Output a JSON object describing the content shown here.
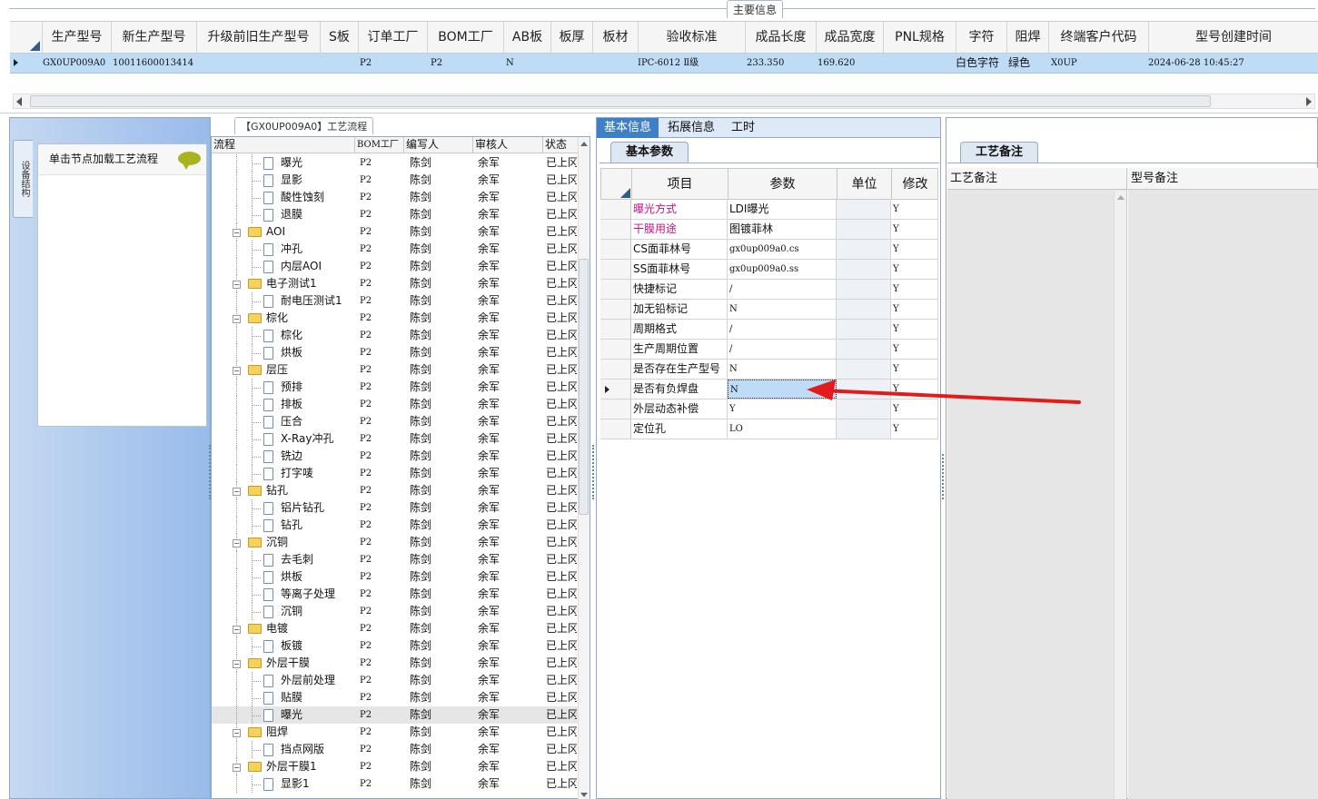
{
  "top": {
    "section_tab": "主要信息",
    "columns": [
      "生产型号",
      "新生产型号",
      "升级前旧生产型号",
      "S板",
      "订单工厂",
      "BOM工厂",
      "AB板",
      "板厚",
      "板材",
      "验收标准",
      "成品长度",
      "成品宽度",
      "PNL规格",
      "字符",
      "阻焊",
      "终端客户代码",
      "型号创建时间"
    ],
    "row": {
      "model": "GX0UP009A0",
      "new_model": "10011600013414",
      "old_model": "",
      "s_board": "",
      "order_factory": "P2",
      "bom_factory": "P2",
      "ab_board": "N",
      "thickness": "",
      "material": "",
      "standard": "IPC-6012 Ⅱ级",
      "length": "233.350",
      "width": "169.620",
      "pnl": "",
      "char": "白色字符",
      "mask": "绿色",
      "customer": "X0UP",
      "created": "2024-06-28 10:45:27"
    }
  },
  "left": {
    "vertical_tab": "设备结构",
    "hint": "单击节点加载工艺流程"
  },
  "tree": {
    "title": "【GX0UP009A0】工艺流程",
    "headers": {
      "flow": "流程",
      "bom": "BOM工厂",
      "author": "编写人",
      "auditor": "审核人",
      "status": "状态"
    },
    "rows": [
      {
        "name": "曝光",
        "level": 2,
        "bom": "P2",
        "author": "陈剑",
        "auditor": "余军",
        "status": "已上冈"
      },
      {
        "name": "显影",
        "level": 2,
        "bom": "P2",
        "author": "陈剑",
        "auditor": "余军",
        "status": "已上冈"
      },
      {
        "name": "酸性蚀刻",
        "level": 2,
        "bom": "P2",
        "author": "陈剑",
        "auditor": "余军",
        "status": "已上冈"
      },
      {
        "name": "退膜",
        "level": 2,
        "bom": "P2",
        "author": "陈剑",
        "auditor": "余军",
        "status": "已上冈"
      },
      {
        "name": "AOI",
        "level": 1,
        "bom": "P2",
        "author": "陈剑",
        "auditor": "余军",
        "status": "已上冈"
      },
      {
        "name": "冲孔",
        "level": 2,
        "bom": "P2",
        "author": "陈剑",
        "auditor": "余军",
        "status": "已上冈"
      },
      {
        "name": "内层AOI",
        "level": 2,
        "bom": "P2",
        "author": "陈剑",
        "auditor": "余军",
        "status": "已上冈"
      },
      {
        "name": "电子测试1",
        "level": 1,
        "bom": "P2",
        "author": "陈剑",
        "auditor": "余军",
        "status": "已上冈"
      },
      {
        "name": "耐电压测试1",
        "level": 2,
        "bom": "P2",
        "author": "陈剑",
        "auditor": "余军",
        "status": "已上冈"
      },
      {
        "name": "棕化",
        "level": 1,
        "bom": "P2",
        "author": "陈剑",
        "auditor": "余军",
        "status": "已上冈"
      },
      {
        "name": "棕化",
        "level": 2,
        "bom": "P2",
        "author": "陈剑",
        "auditor": "余军",
        "status": "已上冈"
      },
      {
        "name": "烘板",
        "level": 2,
        "bom": "P2",
        "author": "陈剑",
        "auditor": "余军",
        "status": "已上冈"
      },
      {
        "name": "层压",
        "level": 1,
        "bom": "P2",
        "author": "陈剑",
        "auditor": "余军",
        "status": "已上冈"
      },
      {
        "name": "预排",
        "level": 2,
        "bom": "P2",
        "author": "陈剑",
        "auditor": "余军",
        "status": "已上冈"
      },
      {
        "name": "排板",
        "level": 2,
        "bom": "P2",
        "author": "陈剑",
        "auditor": "余军",
        "status": "已上冈"
      },
      {
        "name": "压合",
        "level": 2,
        "bom": "P2",
        "author": "陈剑",
        "auditor": "余军",
        "status": "已上冈"
      },
      {
        "name": "X-Ray冲孔",
        "level": 2,
        "bom": "P2",
        "author": "陈剑",
        "auditor": "余军",
        "status": "已上冈"
      },
      {
        "name": "铣边",
        "level": 2,
        "bom": "P2",
        "author": "陈剑",
        "auditor": "余军",
        "status": "已上冈"
      },
      {
        "name": "打字唛",
        "level": 2,
        "bom": "P2",
        "author": "陈剑",
        "auditor": "余军",
        "status": "已上冈"
      },
      {
        "name": "钻孔",
        "level": 1,
        "bom": "P2",
        "author": "陈剑",
        "auditor": "余军",
        "status": "已上冈"
      },
      {
        "name": "铝片钻孔",
        "level": 2,
        "bom": "P2",
        "author": "陈剑",
        "auditor": "余军",
        "status": "已上冈"
      },
      {
        "name": "钻孔",
        "level": 2,
        "bom": "P2",
        "author": "陈剑",
        "auditor": "余军",
        "status": "已上冈"
      },
      {
        "name": "沉铜",
        "level": 1,
        "bom": "P2",
        "author": "陈剑",
        "auditor": "余军",
        "status": "已上冈"
      },
      {
        "name": "去毛刺",
        "level": 2,
        "bom": "P2",
        "author": "陈剑",
        "auditor": "余军",
        "status": "已上冈"
      },
      {
        "name": "烘板",
        "level": 2,
        "bom": "P2",
        "author": "陈剑",
        "auditor": "余军",
        "status": "已上冈"
      },
      {
        "name": "等离子处理",
        "level": 2,
        "bom": "P2",
        "author": "陈剑",
        "auditor": "余军",
        "status": "已上冈"
      },
      {
        "name": "沉铜",
        "level": 2,
        "bom": "P2",
        "author": "陈剑",
        "auditor": "余军",
        "status": "已上冈"
      },
      {
        "name": "电镀",
        "level": 1,
        "bom": "P2",
        "author": "陈剑",
        "auditor": "余军",
        "status": "已上冈"
      },
      {
        "name": "板镀",
        "level": 2,
        "bom": "P2",
        "author": "陈剑",
        "auditor": "余军",
        "status": "已上冈"
      },
      {
        "name": "外层干膜",
        "level": 1,
        "bom": "P2",
        "author": "陈剑",
        "auditor": "余军",
        "status": "已上冈"
      },
      {
        "name": "外层前处理",
        "level": 2,
        "bom": "P2",
        "author": "陈剑",
        "auditor": "余军",
        "status": "已上冈"
      },
      {
        "name": "贴膜",
        "level": 2,
        "bom": "P2",
        "author": "陈剑",
        "auditor": "余军",
        "status": "已上冈"
      },
      {
        "name": "曝光",
        "level": 2,
        "bom": "P2",
        "author": "陈剑",
        "auditor": "余军",
        "status": "已上冈",
        "selected": true
      },
      {
        "name": "阻焊",
        "level": 1,
        "bom": "P2",
        "author": "陈剑",
        "auditor": "余军",
        "status": "已上冈"
      },
      {
        "name": "挡点网版",
        "level": 2,
        "bom": "P2",
        "author": "陈剑",
        "auditor": "余军",
        "status": "已上冈"
      },
      {
        "name": "外层干膜1",
        "level": 1,
        "bom": "P2",
        "author": "陈剑",
        "auditor": "余军",
        "status": "已上冈"
      },
      {
        "name": "显影1",
        "level": 2,
        "bom": "P2",
        "author": "陈剑",
        "auditor": "余军",
        "status": "已上冈"
      }
    ]
  },
  "middle": {
    "tabs": [
      "基本信息",
      "拓展信息",
      "工时"
    ],
    "sub_tab": "基本参数",
    "headers": {
      "item": "项目",
      "param": "参数",
      "unit": "单位",
      "modify": "修改"
    },
    "rows": [
      {
        "item": "曝光方式",
        "param": "LDI曝光",
        "unit": "",
        "modify": "Y",
        "highlight": true
      },
      {
        "item": "干膜用途",
        "param": "图镀菲林",
        "unit": "",
        "modify": "Y",
        "highlight": true
      },
      {
        "item": "CS面菲林号",
        "param": "gx0up009a0.cs",
        "unit": "",
        "modify": "Y"
      },
      {
        "item": "SS面菲林号",
        "param": "gx0up009a0.ss",
        "unit": "",
        "modify": "Y"
      },
      {
        "item": "快捷标记",
        "param": "/",
        "unit": "",
        "modify": "Y"
      },
      {
        "item": "加无铅标记",
        "param": "N",
        "unit": "",
        "modify": "Y"
      },
      {
        "item": "周期格式",
        "param": "/",
        "unit": "",
        "modify": "Y"
      },
      {
        "item": "生产周期位置",
        "param": "/",
        "unit": "",
        "modify": "Y"
      },
      {
        "item": "是否存在生产型号",
        "param": "N",
        "unit": "",
        "modify": "Y"
      },
      {
        "item": "是否有负焊盘",
        "param": "N",
        "unit": "",
        "modify": "Y",
        "current": true
      },
      {
        "item": "外层动态补偿",
        "param": "Y",
        "unit": "",
        "modify": "Y"
      },
      {
        "item": "定位孔",
        "param": "LO",
        "unit": "",
        "modify": "Y"
      }
    ]
  },
  "right": {
    "tab": "工艺备注",
    "col1": "工艺备注",
    "col2": "型号备注"
  },
  "colors": {
    "accent": "#3d80c8",
    "highlight_text": "#c0168a",
    "selected_row": "#bfdcf6",
    "arrow": "#e31b1b"
  }
}
